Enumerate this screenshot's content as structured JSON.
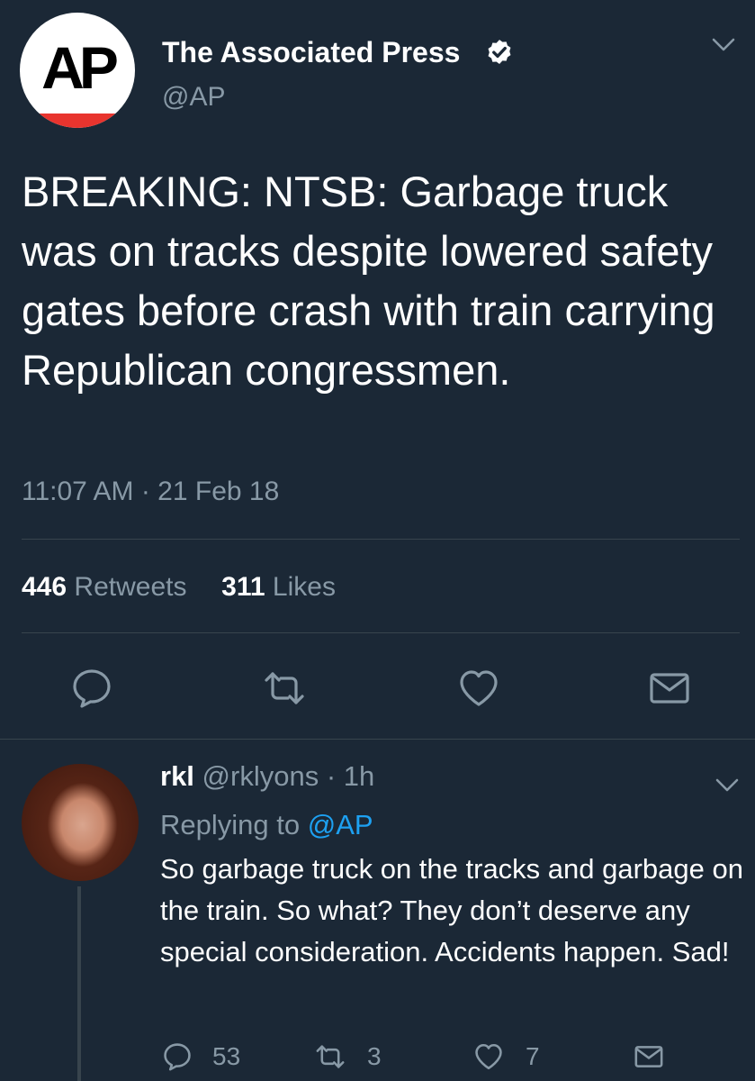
{
  "tweet": {
    "author_name": "The Associated Press",
    "author_handle": "@AP",
    "avatar_text": "AP",
    "text": "BREAKING: NTSB: Garbage truck was on tracks despite lowered safety gates before crash with train carrying Republican congressmen.",
    "timestamp": "11:07 AM · 21 Feb 18",
    "retweets_count": "446",
    "retweets_label": "Retweets",
    "likes_count": "311",
    "likes_label": "Likes",
    "icons": [
      "reply-icon",
      "retweet-icon",
      "like-icon",
      "dm-icon",
      "chevron-down-icon",
      "verified-icon"
    ]
  },
  "reply": {
    "author_name": "rkl",
    "author_handle": "@rklyons",
    "time": "1h",
    "replying_prefix": "Replying to",
    "replying_to": "@AP",
    "text": "So garbage truck on the tracks and garbage on the train. So what? They don’t deserve any special consideration. Accidents happen. Sad!",
    "reply_count": "53",
    "retweet_count": "3",
    "like_count": "7"
  },
  "colors": {
    "background": "#1b2836",
    "muted": "#8899a6",
    "link": "#1da1f2",
    "divider": "#38444d",
    "ap_red": "#e8342e"
  }
}
